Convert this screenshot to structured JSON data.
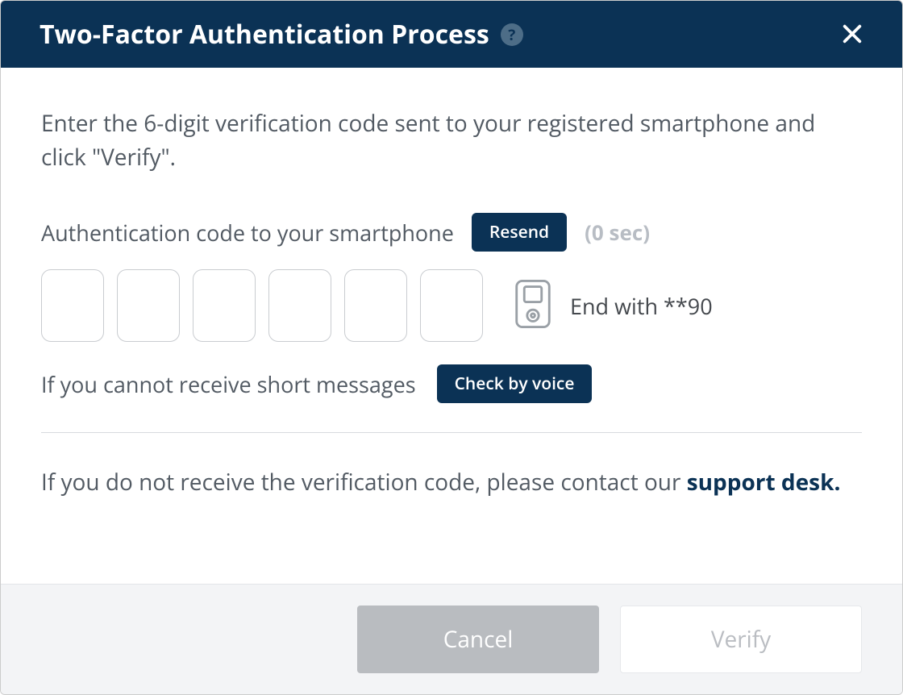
{
  "header": {
    "title": "Two-Factor Authentication Process"
  },
  "body": {
    "intro": "Enter the 6-digit verification code sent to your registered smartphone and click \"Verify\".",
    "auth_label": "Authentication code to your smartphone",
    "resend_label": "Resend",
    "countdown": "(0 sec)",
    "code_values": [
      "",
      "",
      "",
      "",
      "",
      ""
    ],
    "end_with": "End with **90",
    "voice_label": "If you cannot receive short messages",
    "voice_button": "Check by voice",
    "support_text_prefix": "If you do not receive the verification code, please contact our ",
    "support_link": "support desk."
  },
  "footer": {
    "cancel": "Cancel",
    "verify": "Verify"
  }
}
